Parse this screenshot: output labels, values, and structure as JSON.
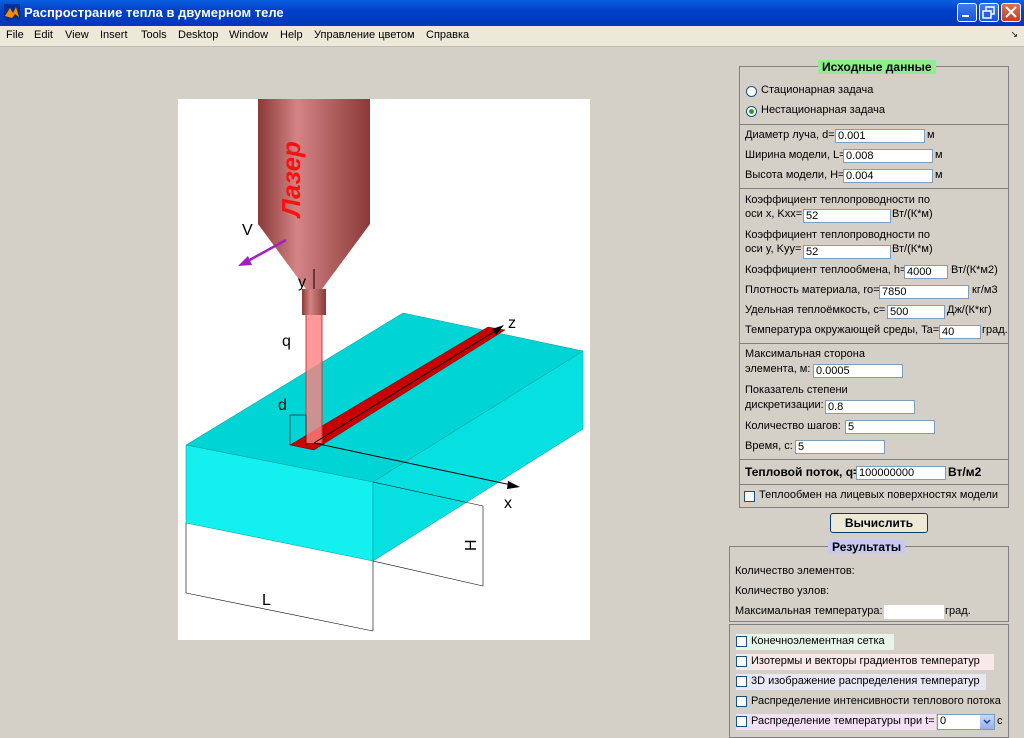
{
  "window": {
    "title": "Распространие тепла в двумерном теле",
    "icon": "matlab-icon",
    "controls": [
      "minimize-icon",
      "maximize-icon",
      "close-icon"
    ]
  },
  "menu": [
    "File",
    "Edit",
    "View",
    "Insert",
    "Tools",
    "Desktop",
    "Window",
    "Help",
    "Управление цветом",
    "Справка"
  ],
  "figure": {
    "laser_label": "Лазер",
    "labels": {
      "v": "V",
      "y": "y",
      "q": "q",
      "z": "z",
      "d": "d",
      "x": "x",
      "H": "H",
      "L": "L"
    }
  },
  "input_panel": {
    "title": "Исходные данные",
    "task_options": [
      {
        "label": "Стационарная задача",
        "selected": false
      },
      {
        "label": "Нестационарная задача",
        "selected": true
      }
    ],
    "beam_diameter": {
      "label": "Диаметр луча, d=",
      "value": "0.001",
      "unit": "м"
    },
    "model_width": {
      "label": "Ширина модели, L=",
      "value": "0.008",
      "unit": "м"
    },
    "model_height": {
      "label": "Высота модели, H=",
      "value": "0.004",
      "unit": "м"
    },
    "kxx": {
      "label_line1": "Коэффициент теплопроводности по",
      "label_line2": "оси x, Kxx=",
      "value": "52",
      "unit": "Вт/(К*м)"
    },
    "kyy": {
      "label_line1": "Коэффициент теплопроводности по",
      "label_line2": "оси y, Kyy=",
      "value": "52",
      "unit": "Вт/(К*м)"
    },
    "h": {
      "label": "Коэффициент теплообмена, h=",
      "value": "4000",
      "unit": "Вт/(К*м2)"
    },
    "ro": {
      "label": "Плотность материала, ro=",
      "value": "7850",
      "unit": "кг/м3"
    },
    "c": {
      "label": "Удельная теплоёмкость, c=",
      "value": "500",
      "unit": "Дж/(К*кг)"
    },
    "ta": {
      "label": "Температура окружающей среды, Ta=",
      "value": "40",
      "unit": "град."
    },
    "max_side": {
      "label_line1": "Максимальная сторона",
      "label_line2": "элемента, м:",
      "value": "0.0005"
    },
    "discretization": {
      "label_line1": "Показатель степени",
      "label_line2": "дискретизации:",
      "value": "0.8"
    },
    "steps": {
      "label": "Количество шагов:",
      "value": "5"
    },
    "time": {
      "label": "Время, с:",
      "value": "5"
    },
    "heat_flux": {
      "label": "Тепловой поток, q=",
      "value": "100000000",
      "unit": "Вт/м2"
    },
    "surface_exchange": {
      "label": "Теплообмен на лицевых поверхностях модели",
      "checked": false
    }
  },
  "compute_button": "Вычислить",
  "results_panel": {
    "title": "Результаты",
    "elements_label": "Количество элементов:",
    "nodes_label": "Количество узлов:",
    "max_temp_label": "Максимальная температура:",
    "max_temp_value": "",
    "max_temp_unit": "град."
  },
  "display_options": [
    {
      "label": "Конечноэлементная сетка",
      "checked": false,
      "bg": "#e8f4e8"
    },
    {
      "label": "Изотермы и векторы градиентов температур",
      "checked": false,
      "bg": "#f8e8e8"
    },
    {
      "label": "3D изображение распределения температур",
      "checked": false,
      "bg": "#e8e8f4"
    },
    {
      "label": "Распределение интенсивности теплового потока",
      "checked": false,
      "bg": "#d4d0c8"
    },
    {
      "label": "Распределение температуры при t=",
      "checked": false,
      "bg": "#f4e0f4",
      "select_value": "0",
      "unit": "с"
    }
  ],
  "colors": {
    "titlebar": "#0040c8",
    "input_title_bg": "#90ee90",
    "results_title_bg": "#c8c8f0",
    "cyan_body": "#00e0e0",
    "track_red": "#c00000",
    "laser_copper": "#b86060"
  }
}
